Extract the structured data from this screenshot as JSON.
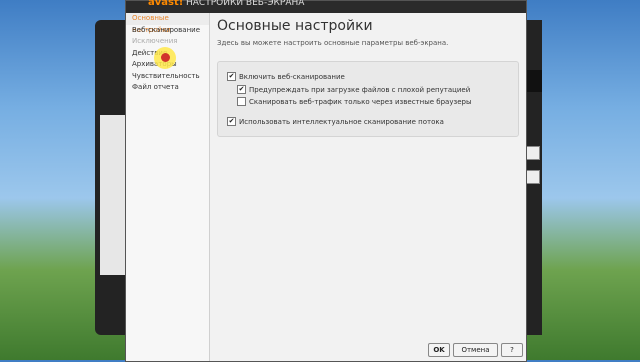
{
  "window": {
    "logo": "avast!",
    "title": "НАСТРОЙКИ ВЕБ-ЭКРАНА"
  },
  "sidebar": {
    "items": [
      {
        "label": "Основные настройки",
        "active": true
      },
      {
        "label": "Веб-сканирование",
        "active": false
      },
      {
        "label": "Исключения",
        "active": false
      },
      {
        "label": "Действия",
        "active": false
      },
      {
        "label": "Архиваторы",
        "active": false
      },
      {
        "label": "Чувствительность",
        "active": false
      },
      {
        "label": "Файл отчета",
        "active": false
      }
    ]
  },
  "content": {
    "title": "Основные настройки",
    "subtitle": "Здесь вы можете настроить основные параметры веб-экрана."
  },
  "options": [
    {
      "label": "Включить веб-сканирование",
      "checked": true
    },
    {
      "label": "Предупреждать при загрузке файлов с плохой репутацией",
      "checked": true
    },
    {
      "label": "Сканировать веб-трафик только через известные браузеры",
      "checked": false
    },
    {
      "label": "Использовать интеллектуальное сканирование потока",
      "checked": true
    }
  ],
  "buttons": {
    "ok": "OK",
    "cancel": "Отмена",
    "help": "?"
  }
}
